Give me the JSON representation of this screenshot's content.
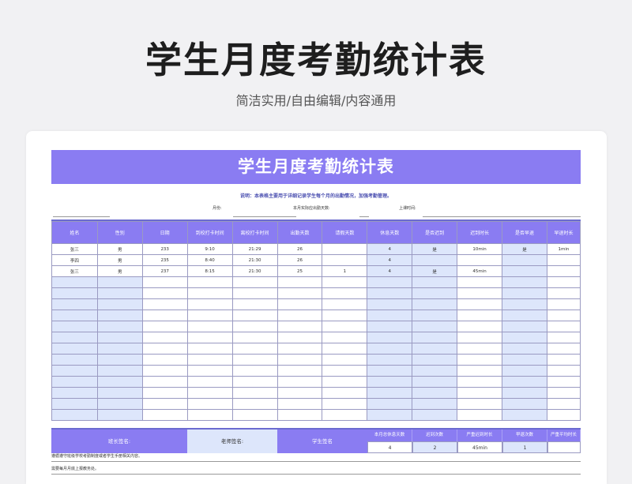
{
  "hero": {
    "title": "学生月度考勤统计表",
    "subtitle": "简洁实用/自由编辑/内容通用"
  },
  "sheet": {
    "title": "学生月度考勤统计表",
    "note": "说明：本表格主要用于详细记录学生每个月的出勤情况，加强考勤管理。",
    "month_label": "月份:",
    "required_days_label": "本月实际应出勤天数:",
    "date_label": "上课时间:"
  },
  "table": {
    "headers": [
      "姓名",
      "性别",
      "日期",
      "到校打卡时间",
      "离校打卡时间",
      "出勤天数",
      "请假天数",
      "休息天数",
      "是否迟到",
      "迟到时长",
      "是否早退",
      "早退时长"
    ],
    "rows": [
      [
        "张三",
        "男",
        "233",
        "9:10",
        "21:29",
        "26",
        "",
        "4",
        "是",
        "10min",
        "是",
        "1min"
      ],
      [
        "李四",
        "男",
        "235",
        "8:40",
        "21:30",
        "26",
        "",
        "4",
        "",
        "",
        "",
        ""
      ],
      [
        "张三",
        "男",
        "237",
        "8:15",
        "21:30",
        "25",
        "1",
        "4",
        "是",
        "45min",
        "",
        ""
      ]
    ],
    "empty_rows": 13
  },
  "footer": {
    "monitor_sign": "班长签名:",
    "teacher_sign": "老师签名:",
    "student_sign": "学生签名",
    "summary_headers": [
      "本月总休息天数",
      "迟到次数",
      "严重迟到时长",
      "早退次数",
      "严重平均时长"
    ],
    "summary_values": [
      "4",
      "2",
      "45min",
      "1",
      ""
    ]
  },
  "notes": {
    "line1": "遵循遵守班级学校考勤制度或者学生手册相关内容。",
    "line2": "需要每月月底上报教务处。"
  },
  "colors": {
    "accent": "#8a7cf2",
    "shade": "#dde6fb"
  }
}
